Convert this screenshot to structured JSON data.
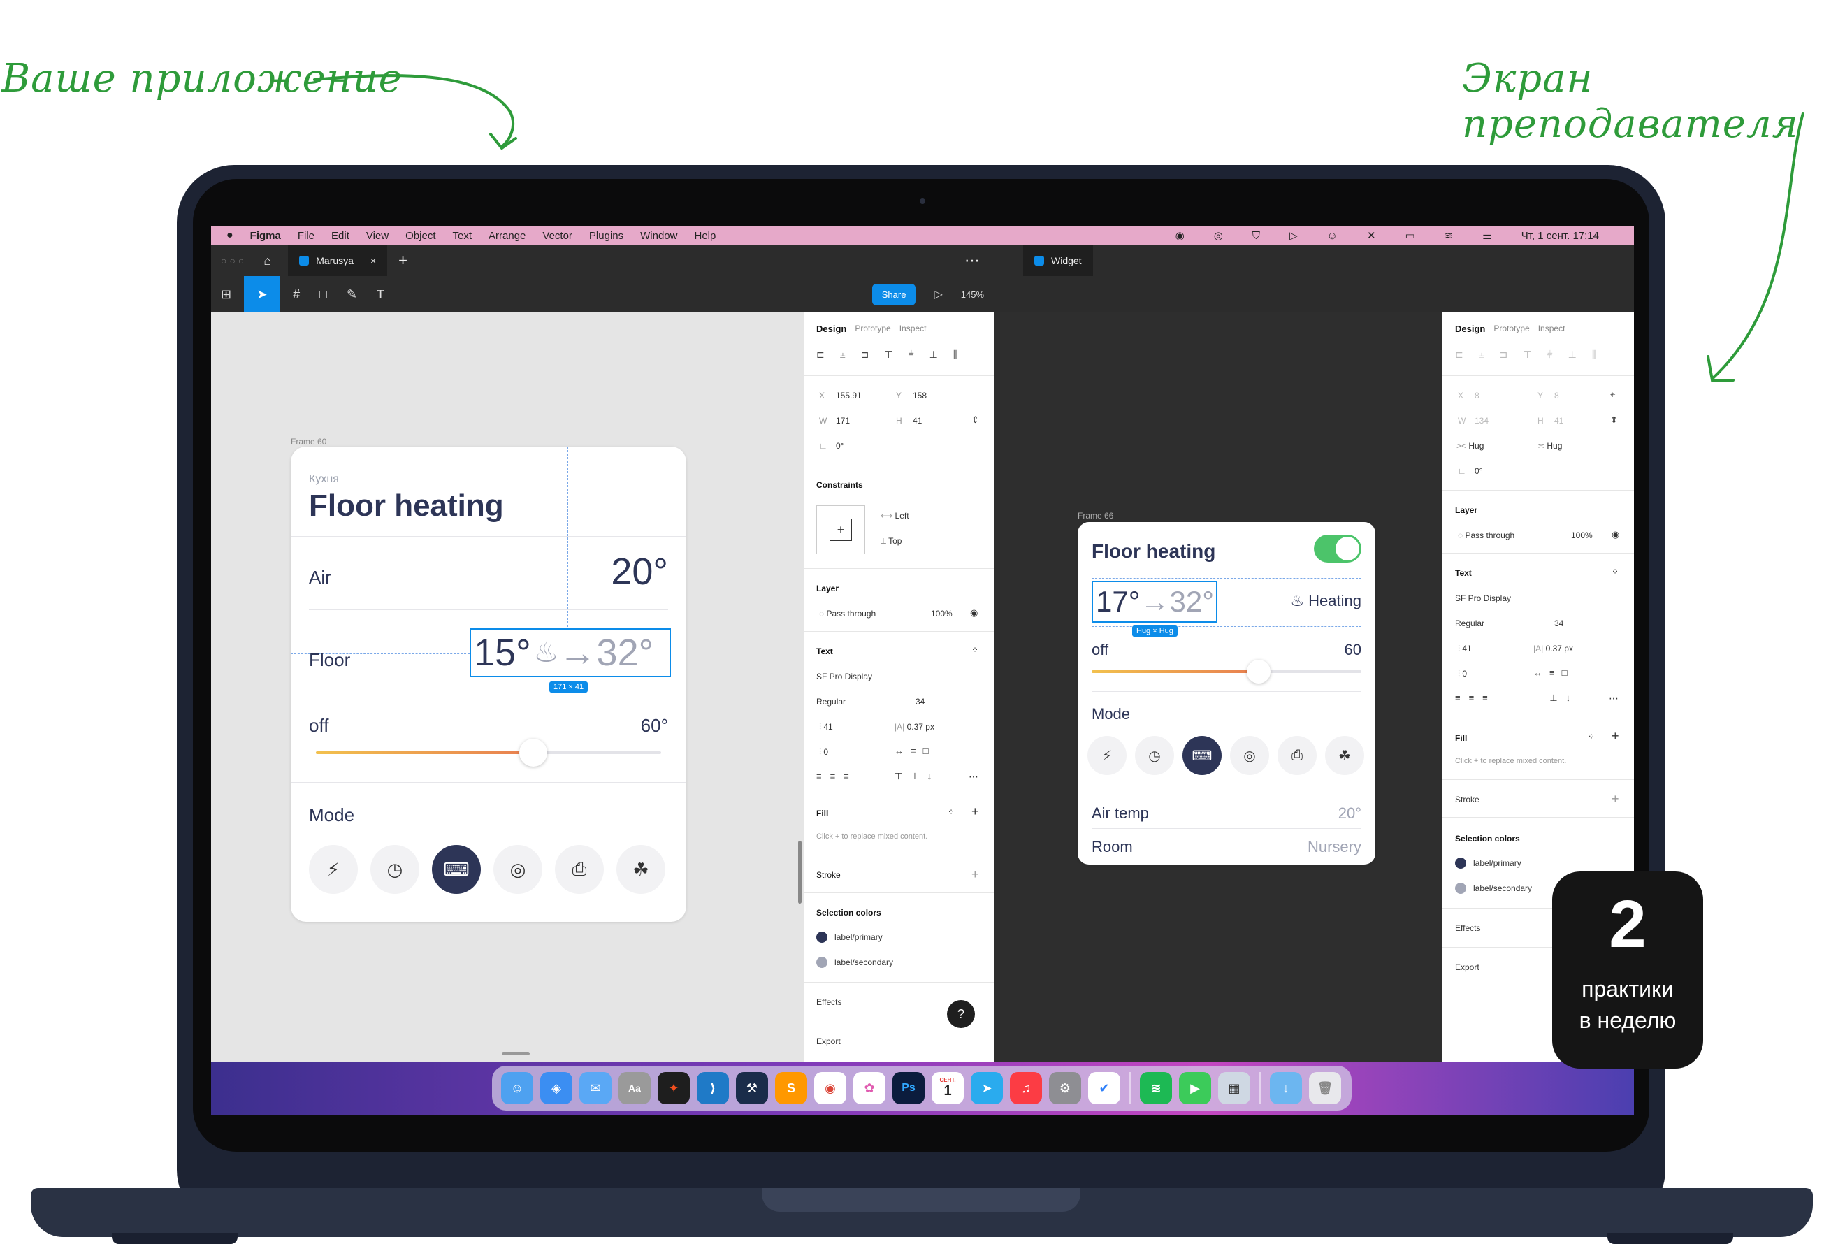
{
  "annotations": {
    "left": "Ваше приложение",
    "right": "Экран преподавателя"
  },
  "badge": {
    "number": "2",
    "line1": "практики",
    "line2": "в неделю"
  },
  "menubar": {
    "apple": "",
    "app": "Figma",
    "items": [
      "File",
      "Edit",
      "View",
      "Object",
      "Text",
      "Arrange",
      "Vector",
      "Plugins",
      "Window",
      "Help"
    ],
    "clock": "Чт, 1 сент.  17:14"
  },
  "tabs": {
    "left_tab": "Marusya",
    "right_tab": "Widget"
  },
  "toolbar": {
    "share": "Share",
    "zoom": "145%"
  },
  "left_frame": {
    "label": "Frame 60",
    "subtitle": "Кухня",
    "title": "Floor heating",
    "air_label": "Air",
    "air_value": "20°",
    "floor_label": "Floor",
    "floor_current": "15°",
    "floor_target": "→32°",
    "size_tag": "171 × 41",
    "slider_left": "off",
    "slider_right": "60°",
    "slider_level": 0.63,
    "mode_label": "Mode"
  },
  "right_frame": {
    "label": "Frame 66",
    "title": "Floor heating",
    "current": "17°",
    "target": "→32°",
    "hug_tag": "Hug × Hug",
    "status": "Heating",
    "slider_left": "off",
    "slider_right": "60",
    "slider_level": 0.62,
    "mode_label": "Mode",
    "rows": [
      {
        "label": "Air temp",
        "value": "20°"
      },
      {
        "label": "Room",
        "value": "Nursery"
      }
    ]
  },
  "panel1": {
    "tabs": [
      "Design",
      "Prototype",
      "Inspect"
    ],
    "x_label": "X",
    "x": "155.91",
    "y_label": "Y",
    "y": "158",
    "w_label": "W",
    "w": "171",
    "h_label": "H",
    "h": "41",
    "rotation": "0°",
    "constraints_title": "Constraints",
    "constraint_h": "Left",
    "constraint_v": "Top",
    "layer_title": "Layer",
    "blend": "Pass through",
    "opacity": "100%",
    "text_title": "Text",
    "font": "SF Pro Display",
    "weight": "Regular",
    "size": "34",
    "line_height": "41",
    "letter": "0.37 px",
    "para": "0",
    "fill_title": "Fill",
    "fill_hint": "Click + to replace mixed content.",
    "stroke_title": "Stroke",
    "sel_title": "Selection colors",
    "sel1": "label/primary",
    "sel2": "label/secondary",
    "effects": "Effects",
    "export": "Export"
  },
  "panel2": {
    "tabs": [
      "Design",
      "Prototype",
      "Inspect"
    ],
    "x_label": "X",
    "x": "8",
    "y_label": "Y",
    "y": "8",
    "w_label": "W",
    "w": "134",
    "h_label": "H",
    "h": "41",
    "hug_w": "Hug",
    "hug_h": "Hug",
    "rotation": "0°",
    "layer_title": "Layer",
    "blend": "Pass through",
    "opacity": "100%",
    "text_title": "Text",
    "font": "SF Pro Display",
    "weight": "Regular",
    "size": "34",
    "line_height": "41",
    "letter": "0.37 px",
    "para": "0",
    "fill_title": "Fill",
    "fill_hint": "Click + to replace mixed content.",
    "stroke_title": "Stroke",
    "sel_title": "Selection colors",
    "sel1": "label/primary",
    "sel2": "label/secondary",
    "effects": "Effects",
    "export": "Export"
  },
  "dock": [
    "Finder",
    "Safari",
    "Mail",
    "Font Book",
    "Figma",
    "VS Code",
    "Xcode",
    "Sublime",
    "Chrome",
    "Photos",
    "Ps",
    "Calendar",
    "Telegram",
    "Music",
    "Settings",
    "Tasks",
    "Spotify",
    "FaceTime",
    "Preview",
    "Downloads",
    "Trash"
  ],
  "calendar": {
    "month": "СЕНТ.",
    "day": "1"
  },
  "colors": {
    "accent": "#2e9b3a",
    "primary": "#2d3557",
    "secondary": "#a1a5b5",
    "figma_blue": "#0c8ce9",
    "gradient_start": "#f2c14e",
    "gradient_end": "#e87e50"
  }
}
